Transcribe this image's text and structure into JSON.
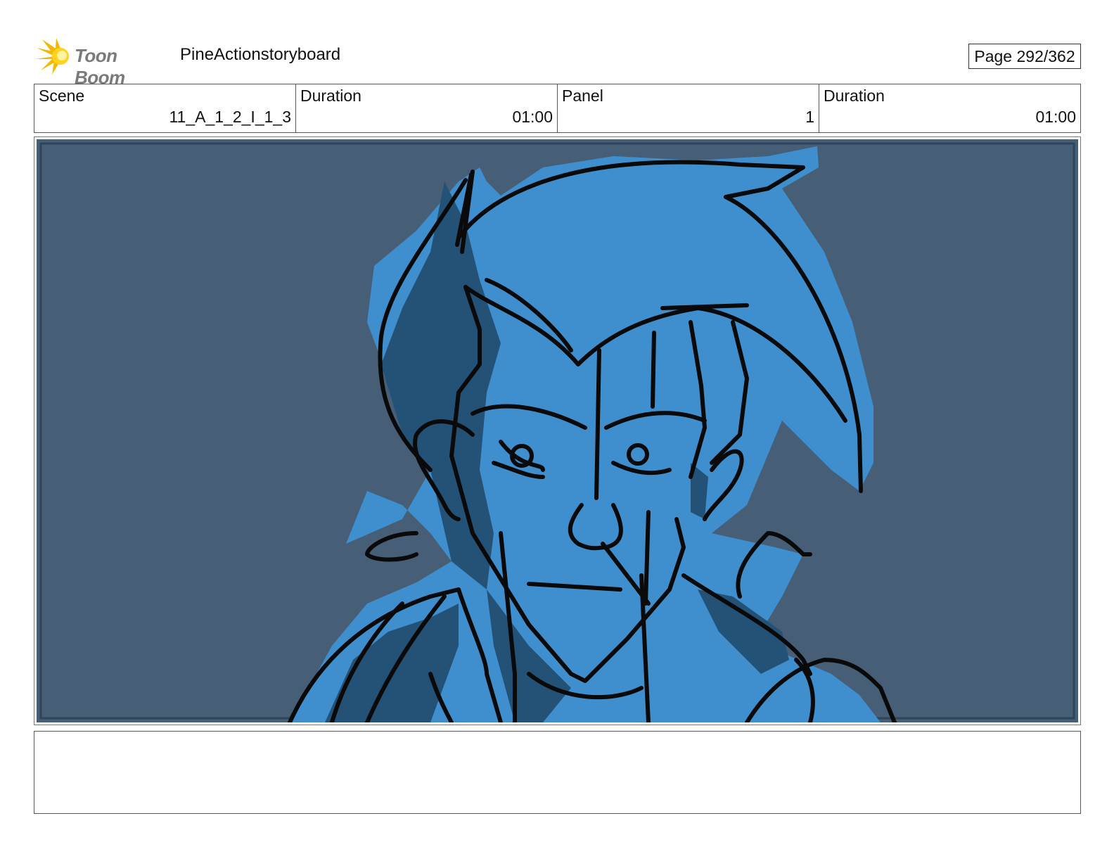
{
  "header": {
    "brand": "Toon Boom",
    "project_title": "PineActionstoryboard",
    "page_label": "Page 292/362"
  },
  "info": [
    {
      "label": "Scene",
      "value": "11_A_1_2_I_1_3"
    },
    {
      "label": "Duration",
      "value": "01:00"
    },
    {
      "label": "Panel",
      "value": "1"
    },
    {
      "label": "Duration",
      "value": "01:00"
    }
  ],
  "panel": {
    "background_color": "#465e76",
    "fill_color": "#3f8fcf",
    "shadow_color": "#245277",
    "line_color": "#0a0a0a"
  },
  "notes": {
    "text": ""
  }
}
